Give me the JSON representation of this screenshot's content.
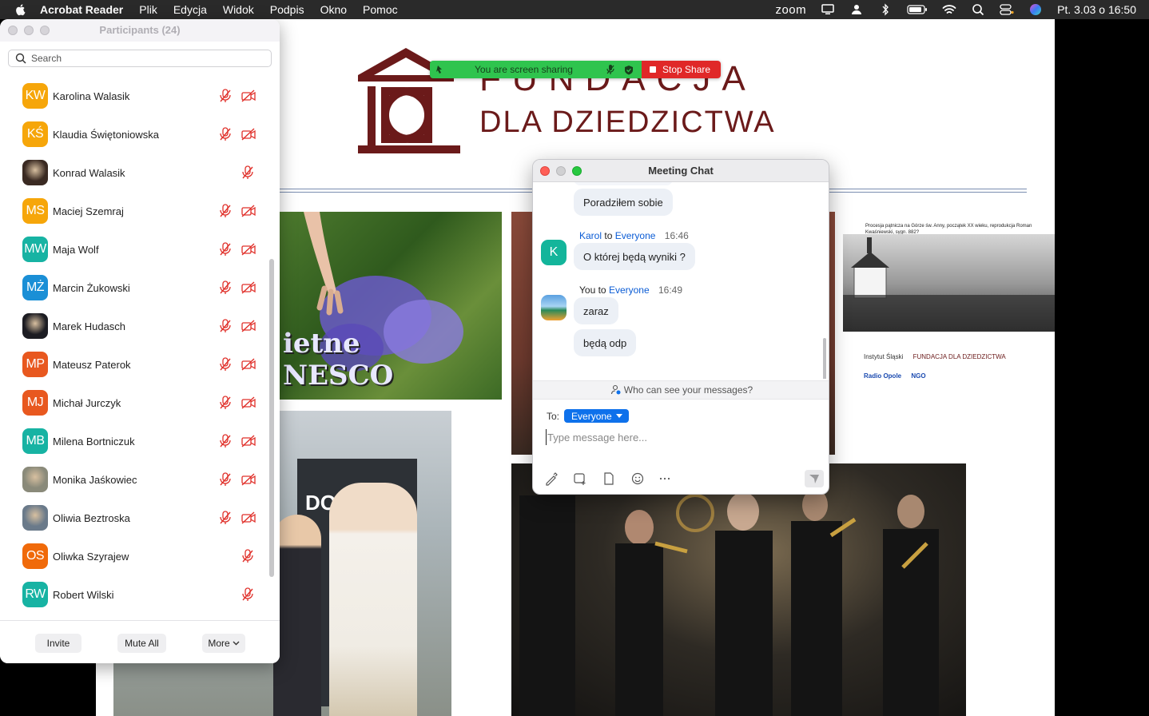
{
  "menubar": {
    "app_name": "Acrobat Reader",
    "menus": [
      "Plik",
      "Edycja",
      "Widok",
      "Podpis",
      "Okno",
      "Pomoc"
    ],
    "zoom_label": "zoom",
    "datetime": "Pt. 3.03 o  16:50"
  },
  "document": {
    "logo_line1": "FUNDACJA",
    "logo_line2": "DLA DZIEDZICTWA",
    "photo_caption": "ietne\nNESCO",
    "photo_caption_1": "ietne",
    "photo_caption_2": "NESCO",
    "poster_caption": "Procesja pątnicza na Górze św. Anny, początek XX wieku, reprodukcja Roman Kwaśniewski, sygn. 882?",
    "poster_logos": [
      "Instytut Śląski",
      "FUNDACJA DLA DZIEDZICTWA",
      "Radio Opole",
      "NGO"
    ],
    "office_sign": "DOXA"
  },
  "participants": {
    "title": "Participants (24)",
    "search_placeholder": "Search",
    "list": [
      {
        "initials": "KW",
        "name": "Karolina Walasik",
        "color": "#f6a60a",
        "video_off": true
      },
      {
        "initials": "KŚ",
        "name": "Klaudia Świętoniowska",
        "color": "#f6a60a",
        "video_off": true
      },
      {
        "initials": "",
        "name": "Konrad Walasik",
        "color": "#3a2a22",
        "video_off": false
      },
      {
        "initials": "MS",
        "name": "Maciej Szemraj",
        "color": "#f6a60a",
        "video_off": true
      },
      {
        "initials": "MW",
        "name": "Maja Wolf",
        "color": "#17b3a3",
        "video_off": true
      },
      {
        "initials": "MŻ",
        "name": "Marcin Żukowski",
        "color": "#1a8fd6",
        "video_off": true
      },
      {
        "initials": "",
        "name": "Marek Hudasch",
        "color": "#1c1c22",
        "video_off": true
      },
      {
        "initials": "MP",
        "name": "Mateusz Paterok",
        "color": "#e8581f",
        "video_off": true
      },
      {
        "initials": "MJ",
        "name": "Michał Jurczyk",
        "color": "#e8581f",
        "video_off": true
      },
      {
        "initials": "MB",
        "name": "Milena Bortniczuk",
        "color": "#17b3a3",
        "video_off": true
      },
      {
        "initials": "",
        "name": "Monika Jaśkowiec",
        "color": "#8a8a7a",
        "video_off": true
      },
      {
        "initials": "",
        "name": "Oliwia Beztroska",
        "color": "#6a7a8a",
        "video_off": true
      },
      {
        "initials": "OS",
        "name": "Oliwka Szyrajew",
        "color": "#f06a0a",
        "video_off": false
      },
      {
        "initials": "RW",
        "name": "Robert Wilski",
        "color": "#17b3a3",
        "video_off": false
      }
    ],
    "buttons": {
      "invite": "Invite",
      "mute_all": "Mute All",
      "more": "More"
    }
  },
  "share_bar": {
    "status": "You are screen sharing",
    "stop": "Stop Share",
    "accent_green": "#2fc44e",
    "accent_red": "#e02828"
  },
  "chat": {
    "title": "Meeting Chat",
    "messages": [
      {
        "text": "Poradziłem sobie"
      },
      {
        "sender": "Karol",
        "to_word": "to",
        "recipient": "Everyone",
        "time": "16:46",
        "avatar": "K",
        "text": "O której będą wyniki ?"
      },
      {
        "sender": "You",
        "to_word": "to",
        "recipient": "Everyone",
        "time": "16:49",
        "text": "zaraz"
      },
      {
        "text": "będą odp"
      }
    ],
    "privacy": "Who can see your messages?",
    "to_label": "To:",
    "recipient": "Everyone",
    "input_placeholder": "Type message here..."
  }
}
